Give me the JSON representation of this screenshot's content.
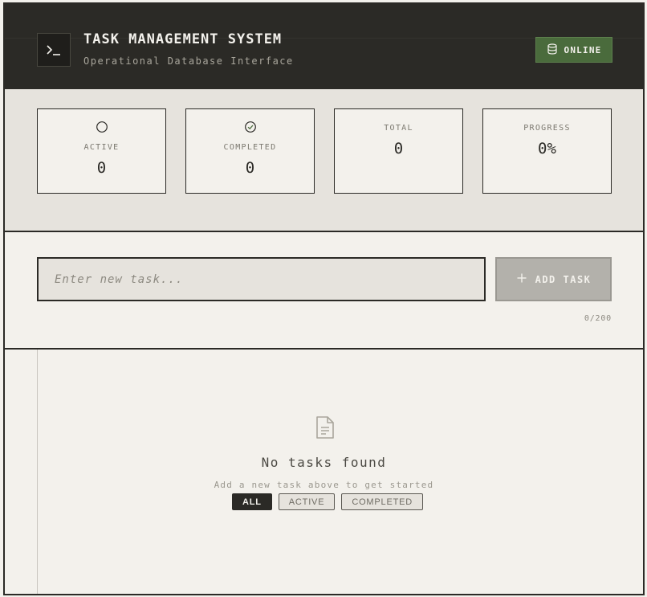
{
  "header": {
    "title": "TASK MANAGEMENT SYSTEM",
    "subtitle": "Operational Database Interface",
    "terminal_icon": "terminal-icon",
    "status": {
      "label": "ONLINE",
      "icon": "database-icon",
      "color": "#4a6b3c"
    }
  },
  "stats": [
    {
      "label": "ACTIVE",
      "value": "0",
      "icon": "circle-icon"
    },
    {
      "label": "COMPLETED",
      "value": "0",
      "icon": "check-circle-icon"
    },
    {
      "label": "TOTAL",
      "value": "0"
    },
    {
      "label": "PROGRESS",
      "value": "0%"
    }
  ],
  "input": {
    "placeholder": "Enter new task...",
    "value": "",
    "add_label": "ADD TASK",
    "add_icon": "plus-icon",
    "char_count": "0/200"
  },
  "list": {
    "empty_icon": "document-icon",
    "empty_title": "No tasks found",
    "empty_subtitle": "Add a new task above to get started",
    "filters": [
      {
        "label": "ALL",
        "active": true
      },
      {
        "label": "ACTIVE",
        "active": false
      },
      {
        "label": "COMPLETED",
        "active": false
      }
    ]
  },
  "colors": {
    "dark": "#2b2a26",
    "paper": "#f3f1ec",
    "panel": "#e6e3dd",
    "online_green": "#4a6b3c",
    "button_disabled": "#b3b1ab"
  }
}
